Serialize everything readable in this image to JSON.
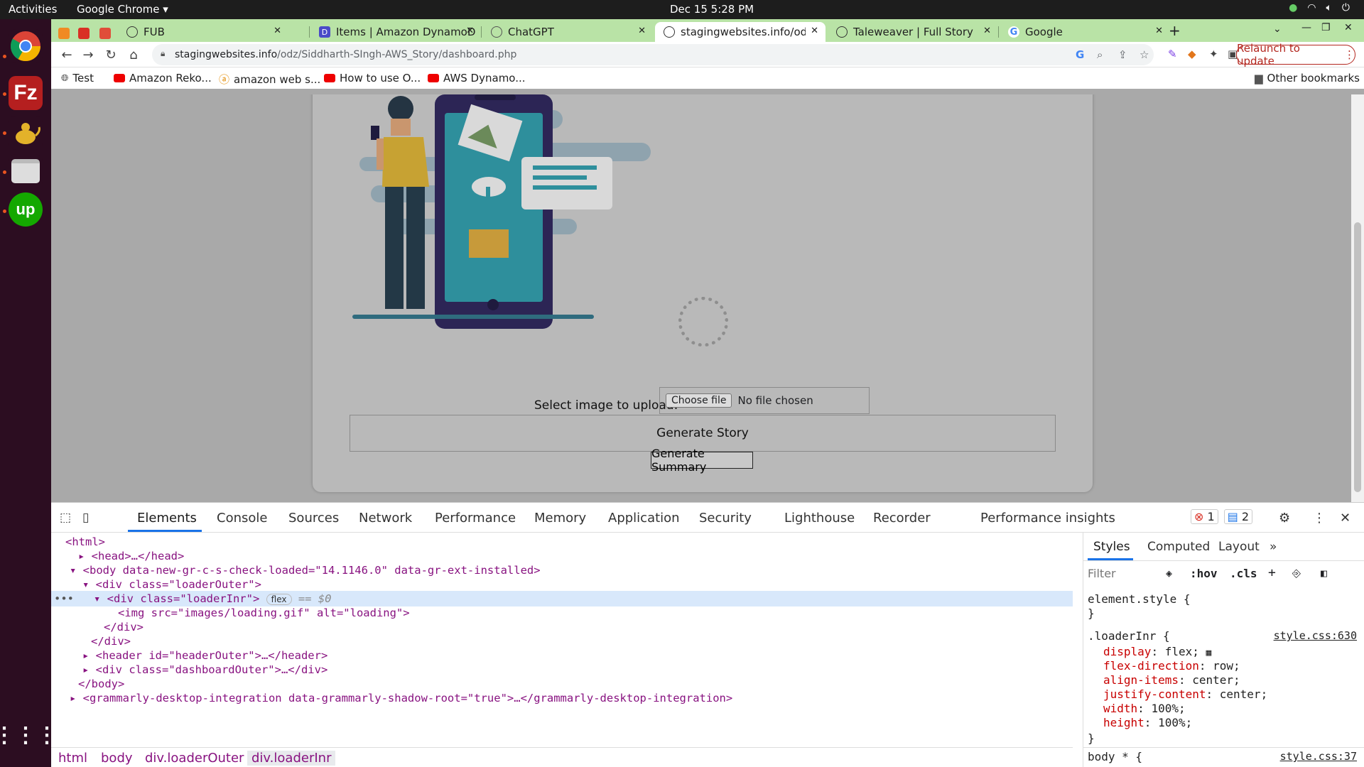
{
  "topbar": {
    "activities": "Activities",
    "app": "Google Chrome ▾",
    "clock": "Dec 15  5:28 PM"
  },
  "tabs": [
    {
      "label": "FUB"
    },
    {
      "label": "Items | Amazon DynamoD"
    },
    {
      "label": "ChatGPT"
    },
    {
      "label": "stagingwebsites.info/odz"
    },
    {
      "label": "Taleweaver | Full Story"
    },
    {
      "label": "Google"
    }
  ],
  "url": {
    "domain": "stagingwebsites.info",
    "path": "/odz/Siddharth-SIngh-AWS_Story/dashboard.php"
  },
  "relaunch": "Relaunch to update",
  "bookmarks": [
    {
      "label": "Test"
    },
    {
      "label": "Amazon Reko..."
    },
    {
      "label": "amazon web s..."
    },
    {
      "label": "How to use O..."
    },
    {
      "label": "AWS Dynamo..."
    }
  ],
  "other_bookmarks": "Other bookmarks",
  "page": {
    "upload_label": "Select image to upload:",
    "choose_file": "Choose file",
    "no_file": "No file chosen",
    "generate_story": "Generate Story",
    "generate_summary": "Generate Summary"
  },
  "devtools": {
    "tabs": [
      "Elements",
      "Console",
      "Sources",
      "Network",
      "Performance",
      "Memory",
      "Application",
      "Security",
      "Lighthouse",
      "Recorder",
      "Performance insights"
    ],
    "errors": "1",
    "messages": "2",
    "dom_lines": [
      "<html>",
      "<head>…</head>",
      "<body data-new-gr-c-s-check-loaded=\"14.1146.0\" data-gr-ext-installed>",
      "<div class=\"loaderOuter\">",
      "<div class=\"loaderInr\">",
      "<img src=\"images/loading.gif\" alt=\"loading\">",
      "</div>",
      "</div>",
      "<header id=\"headerOuter\">…</header>",
      "<div class=\"dashboardOuter\">…</div>",
      "</body>",
      "<grammarly-desktop-integration data-grammarly-shadow-root=\"true\">…</grammarly-desktop-integration>"
    ],
    "selected_badge": "flex",
    "selected_marker": "== $0",
    "breadcrumbs": [
      "html",
      "body",
      "div.loaderOuter",
      "div.loaderInr"
    ],
    "styles_tabs": [
      "Styles",
      "Computed",
      "Layout"
    ],
    "filter_placeholder": "Filter",
    "hov": ":hov",
    "cls": ".cls",
    "element_style": "element.style {",
    "close_brace": "}",
    "rule_selector": ".loaderInr {",
    "rule_source": "style.css:630",
    "rule_props": [
      {
        "p": "display",
        "v": "flex;"
      },
      {
        "p": "flex-direction",
        "v": "row;"
      },
      {
        "p": "align-items",
        "v": "center;"
      },
      {
        "p": "justify-content",
        "v": "center;"
      },
      {
        "p": "width",
        "v": "100%;"
      },
      {
        "p": "height",
        "v": "100%;"
      }
    ],
    "next_selector": "body * {",
    "next_source": "style.css:37"
  }
}
